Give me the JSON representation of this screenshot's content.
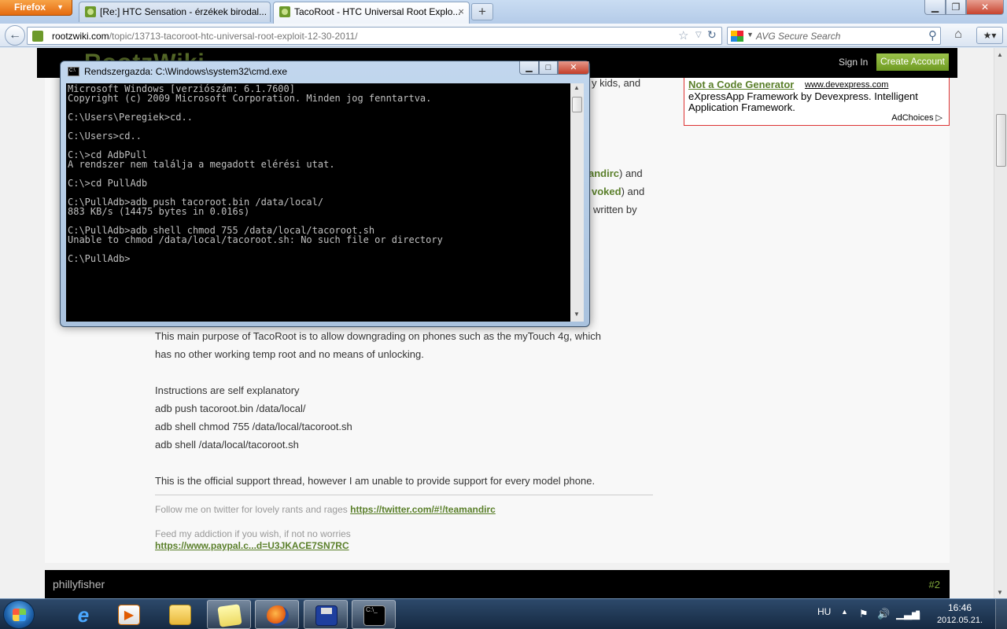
{
  "browser": {
    "menu_label": "Firefox",
    "tabs": [
      {
        "title": "[Re:] HTC Sensation - érzékek birodal..."
      },
      {
        "title": "TacoRoot - HTC Universal Root Explo..."
      }
    ],
    "url_domain": "rootzwiki.com",
    "url_path": "/topic/13713-tacoroot-htc-universal-root-exploit-12-30-2011/",
    "search_placeholder": "AVG Secure Search"
  },
  "site": {
    "logo": "RootzWiki",
    "signin": "Sign In",
    "create_account": "Create Account"
  },
  "ad": {
    "title": "Not a Code Generator",
    "url": "www.devexpress.com",
    "desc": "eXpressApp Framework by Devexpress. Intelligent Application Framework.",
    "adchoices": "AdChoices"
  },
  "post": {
    "partial_1": "y kids, and",
    "partial_2_bold": "andirc",
    "partial_2": ") and",
    "partial_3_bold": "voked",
    "partial_3": ") and",
    "partial_4": "written by",
    "lines": [
      "This main purpose of TacoRoot is to allow downgrading on phones such as the myTouch 4g, which",
      "has no other working temp root and no means of unlocking.",
      "Instructions are self explanatory",
      "adb push tacoroot.bin /data/local/",
      "adb shell chmod 755 /data/local/tacoroot.sh",
      "adb shell /data/local/tacoroot.sh",
      "This is the official support thread, however I am unable to provide support for every model phone."
    ],
    "sig_1": "Follow me on twitter for lovely rants and rages",
    "sig_1_link": "https://twitter.com/#!/teamandirc",
    "sig_2": "Feed my addiction if you wish, if not no worries",
    "sig_2_link": "https://www.paypal.c...d=U3JKACE7SN7RC"
  },
  "next_post": {
    "author": "phillyfisher",
    "number": "#2"
  },
  "cmd": {
    "title": "Rendszergazda: C:\\Windows\\system32\\cmd.exe",
    "output": "Microsoft Windows [verziószám: 6.1.7600]\nCopyright (c) 2009 Microsoft Corporation. Minden jog fenntartva.\n\nC:\\Users\\Peregiek>cd..\n\nC:\\Users>cd..\n\nC:\\>cd AdbPull\nA rendszer nem találja a megadott elérési utat.\n\nC:\\>cd PullAdb\n\nC:\\PullAdb>adb push tacoroot.bin /data/local/\n883 KB/s (14475 bytes in 0.016s)\n\nC:\\PullAdb>adb shell chmod 755 /data/local/tacoroot.sh\nUnable to chmod /data/local/tacoroot.sh: No such file or directory\n\nC:\\PullAdb>"
  },
  "taskbar": {
    "lang": "HU",
    "time": "16:46",
    "date": "2012.05.21."
  },
  "icons": {
    "back": "back-arrow-icon",
    "star": "bookmark-star-icon",
    "reload": "reload-icon",
    "search": "search-icon",
    "home": "home-icon"
  }
}
